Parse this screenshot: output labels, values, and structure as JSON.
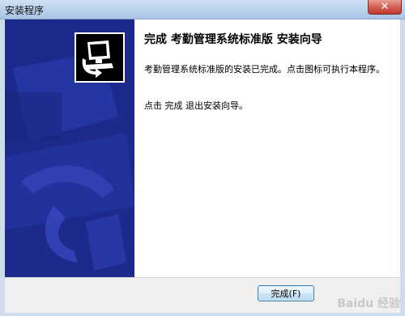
{
  "window": {
    "title": "安装程序",
    "close_symbol": "✕"
  },
  "content": {
    "heading": "完成 考勤管理系统标准版 安装向导",
    "description": "考勤管理系统标准版的安装已完成。点击图标可执行本程序。",
    "instruction": "点击 完成 退出安装向导。"
  },
  "buttons": {
    "finish_label": "完成(F)"
  },
  "watermark": {
    "text": "Baidu 经验"
  },
  "colors": {
    "banner": "#1d2a8c",
    "accent": "#3c7fb1"
  }
}
